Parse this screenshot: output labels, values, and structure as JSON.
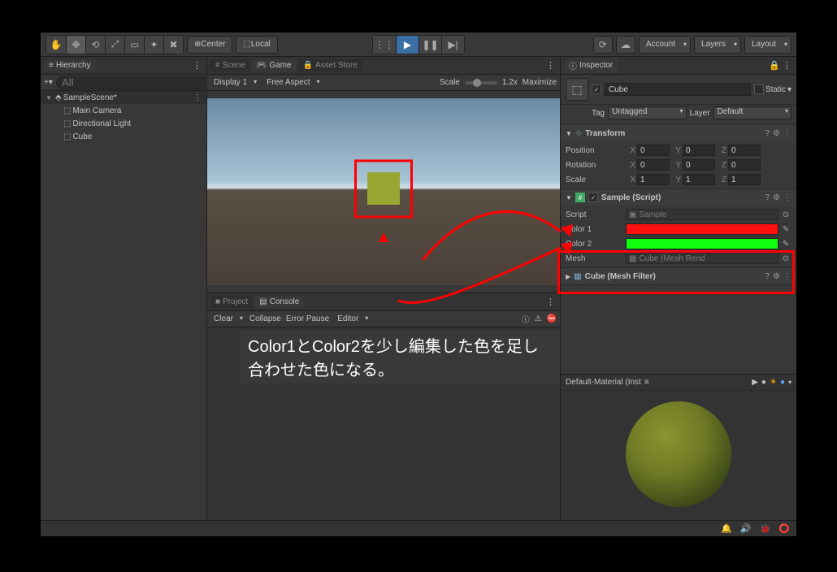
{
  "toolbar": {
    "center_label": "Center",
    "local_label": "Local",
    "account": "Account",
    "layers": "Layers",
    "layout": "Layout"
  },
  "hierarchy": {
    "title": "Hierarchy",
    "search_placeholder": "All",
    "scene": "SampleScene*",
    "items": [
      "Main Camera",
      "Directional Light",
      "Cube"
    ]
  },
  "scene_tab": "Scene",
  "game_tab": "Game",
  "asset_tab": "Asset Store",
  "game_bar": {
    "display": "Display 1",
    "aspect": "Free Aspect",
    "scale_label": "Scale",
    "scale_val": "1.2x",
    "maximize": "Maximize"
  },
  "project_tab": "Project",
  "console_tab": "Console",
  "proj_bar": {
    "clear": "Clear",
    "collapse": "Collapse",
    "error_pause": "Error Pause",
    "editor": "Editor"
  },
  "annotation": "Color1とColor2を少し編集した色を足し合わせた色になる。",
  "inspector": {
    "title": "Inspector",
    "object_name": "Cube",
    "static_label": "Static",
    "tag_label": "Tag",
    "tag_value": "Untagged",
    "layer_label": "Layer",
    "layer_value": "Default",
    "transform": {
      "title": "Transform",
      "position": "Position",
      "rotation": "Rotation",
      "scale": "Scale",
      "pos": [
        "0",
        "0",
        "0"
      ],
      "rot": [
        "0",
        "0",
        "0"
      ],
      "scl": [
        "1",
        "1",
        "1"
      ]
    },
    "sample": {
      "title": "Sample (Script)",
      "script_label": "Script",
      "script_value": "Sample",
      "color1_label": "Color 1",
      "color2_label": "Color 2",
      "mesh_label": "Mesh",
      "mesh_value": "Cube (Mesh Rend",
      "color1": "#ff1010",
      "color2": "#10ff10"
    },
    "mesh_filter": {
      "title": "Cube (Mesh Filter)"
    },
    "material_head": "Default-Material (Inst"
  },
  "status_icons": [
    "🔔",
    "🔊",
    "🐞",
    "⭕"
  ]
}
